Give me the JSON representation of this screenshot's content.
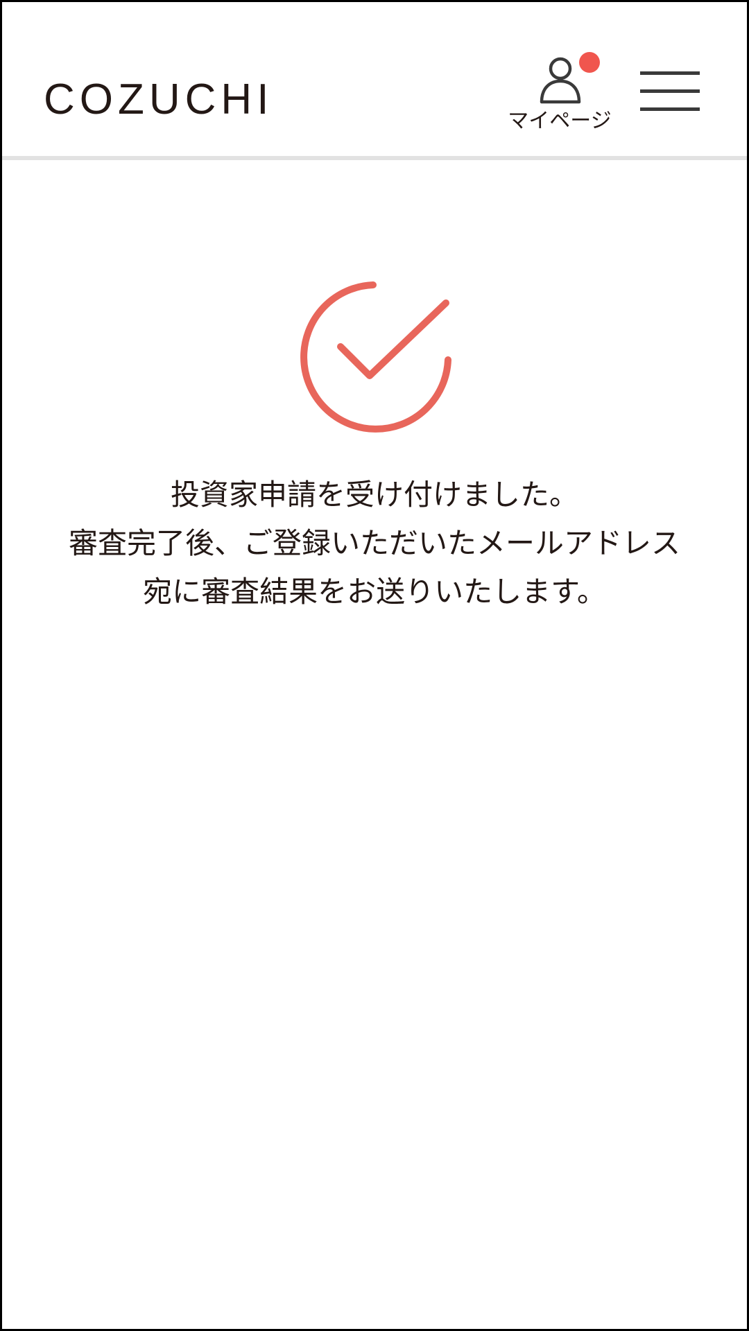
{
  "header": {
    "logo_text": "COZUCHI",
    "mypage_label": "マイページ",
    "mypage_icon": "user-icon",
    "notification_color": "#f0564e",
    "menu_icon": "hamburger-menu-icon"
  },
  "main": {
    "status_icon": "check-circle-icon",
    "accent_color": "#e8665b",
    "message_lines": [
      "投資家申請を受け付けました。",
      "審査完了後、ご登録いただいたメールアドレス",
      "宛に審査結果をお送りいたします。"
    ]
  }
}
